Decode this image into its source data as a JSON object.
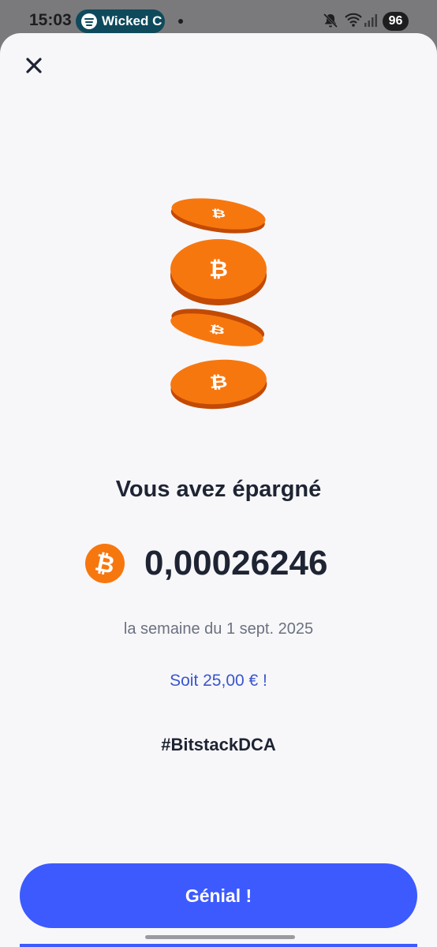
{
  "status_bar": {
    "time": "15:03",
    "now_playing": "Wicked C",
    "battery": "96",
    "icons": [
      "spotify-icon",
      "mute-icon",
      "wifi-icon",
      "signal-icon"
    ]
  },
  "sheet": {
    "close_icon": "close-icon",
    "illustration": "bitcoin-coins",
    "headline": "Vous avez épargné",
    "amount": "0,00026246",
    "currency_icon": "bitcoin-icon",
    "period": "la semaine du 1 sept. 2025",
    "fiat_equivalent": "Soit 25,00 € !",
    "hashtag": "#BitstackDCA",
    "cta_label": "Génial !"
  },
  "colors": {
    "accent": "#3d5afe",
    "bitcoin_orange": "#f7770f",
    "link_blue": "#3a55cf",
    "text_dark": "#1e2433",
    "text_muted": "#6b7180",
    "sheet_background": "#f7f7f9"
  }
}
